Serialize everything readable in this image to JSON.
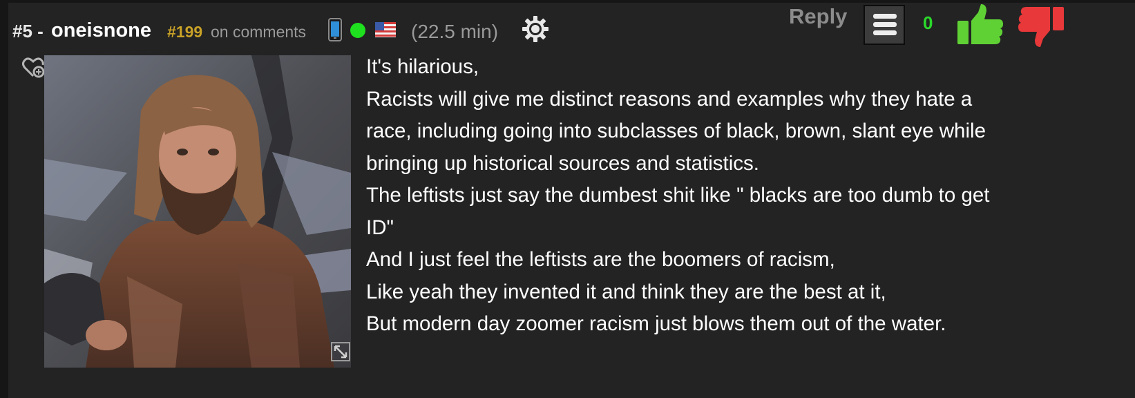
{
  "comment": {
    "number": "#5 -",
    "username": "oneisnone",
    "rank": "#199",
    "rank_suffix": "on comments",
    "time": "(22.5 min)",
    "reply_label": "Reply",
    "score": "0",
    "icons": {
      "device": "phone-icon",
      "status": "online-dot",
      "flag": "us-flag-icon",
      "settings": "gear-icon",
      "menu": "hamburger-icon",
      "upvote": "thumbs-up-icon",
      "downvote": "thumbs-down-icon",
      "favorite": "heart-icon",
      "expand": "expand-icon"
    },
    "colors": {
      "rank": "#c9a227",
      "score": "#2bd92b",
      "upvote": "#5fd135",
      "downvote": "#e8383a",
      "online": "#1fe01f"
    },
    "lines": [
      "It's hilarious,",
      "Racists will give me distinct reasons and examples why they hate a",
      "race, including going into subclasses of black, brown, slant eye while",
      "bringing up historical sources and statistics.",
      "The leftists just say the dumbest shit like \" blacks are too dumb to get",
      "ID\"",
      "And I just feel the leftists are the boomers of racism,",
      "Like yeah they invented it and think they are the best at it,",
      "But modern day zoomer racism just blows them out of the water."
    ]
  }
}
